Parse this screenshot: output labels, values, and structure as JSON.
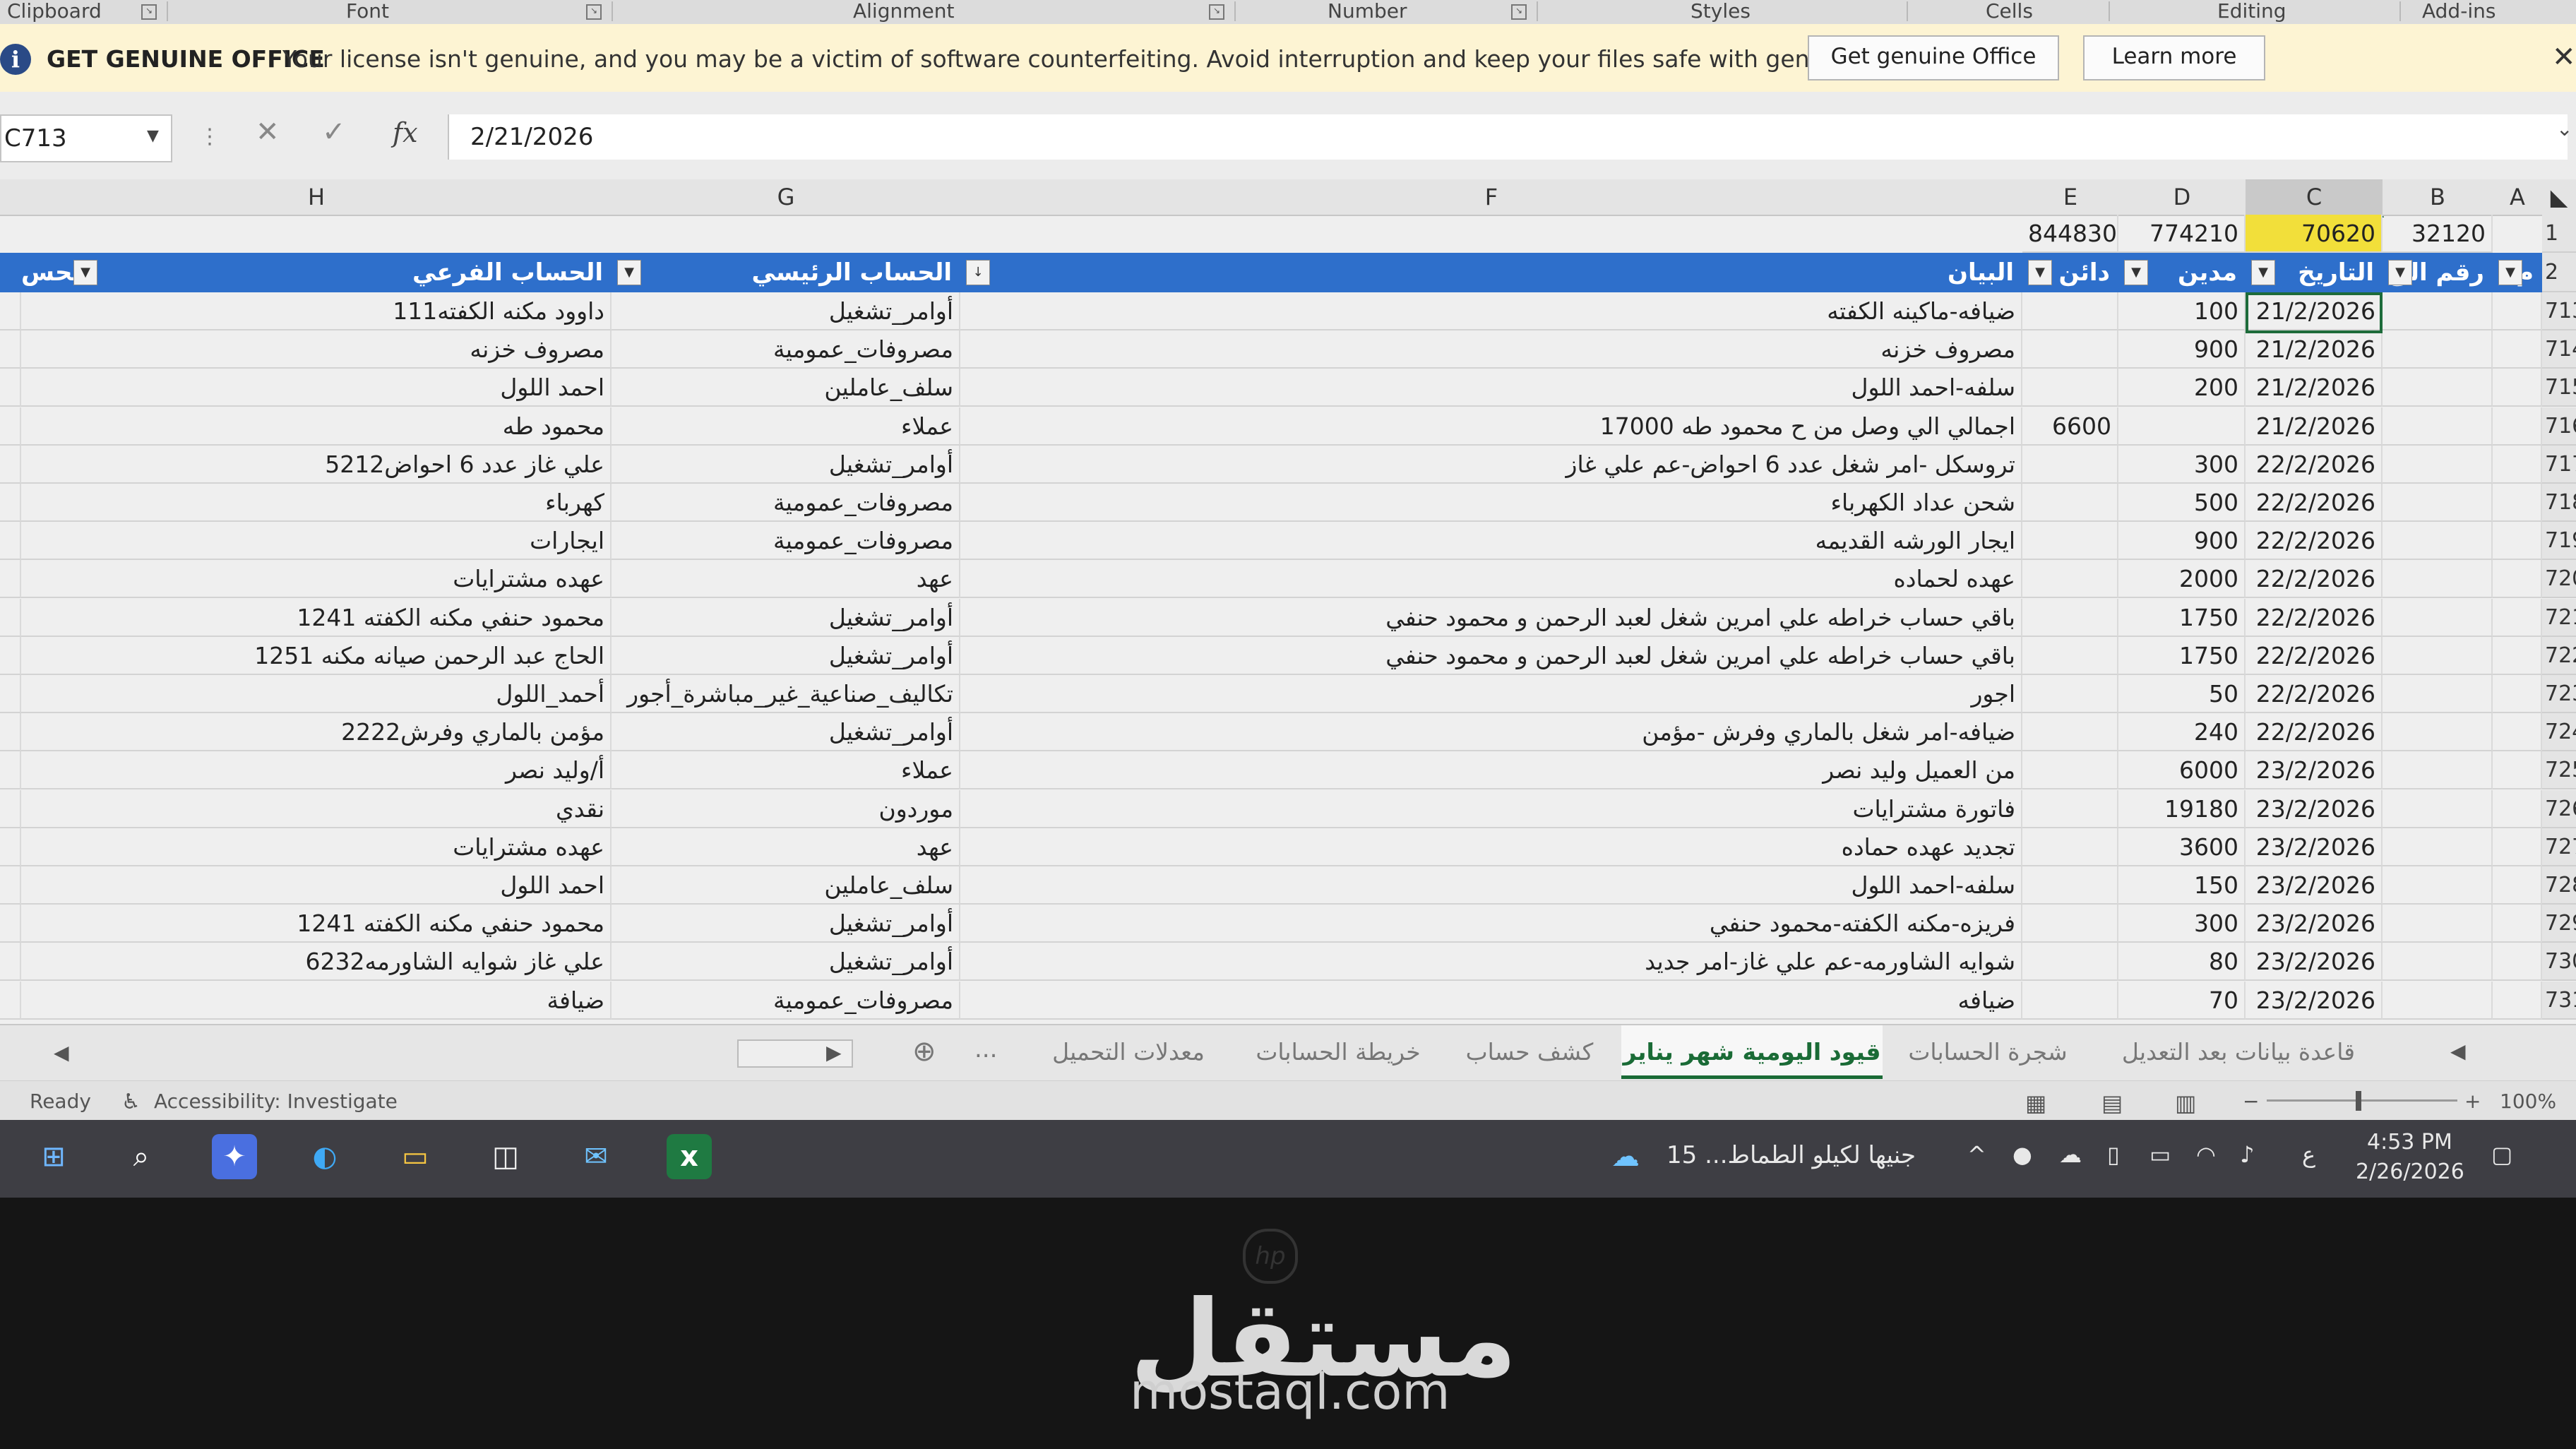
{
  "ribbon": {
    "groups": [
      "Clipboard",
      "Font",
      "Alignment",
      "Number",
      "Styles",
      "Cells",
      "Editing",
      "Add-ins"
    ]
  },
  "infobar": {
    "heading": "GET GENUINE OFFICE",
    "message": "Your license isn't genuine, and you may be a victim of software counterfeiting. Avoid interruption and keep your files safe with genuine Office today.",
    "btn_primary": "Get genuine Office",
    "btn_secondary": "Learn more"
  },
  "formula_bar": {
    "name_box": "C713",
    "value": "2/21/2026"
  },
  "columns": [
    "H",
    "G",
    "F",
    "E",
    "D",
    "C",
    "B",
    "A"
  ],
  "row_labels": [
    "1",
    "2",
    "713",
    "714",
    "715",
    "716",
    "717",
    "718",
    "719",
    "720",
    "721",
    "722",
    "723",
    "724",
    "725",
    "726",
    "727",
    "728",
    "729",
    "730",
    "731"
  ],
  "totals_row": {
    "E": "844830",
    "D": "774210",
    "C": "70620",
    "B": "32120"
  },
  "headers": {
    "I": "الحس",
    "H": "الحساب الفرعي",
    "G": "الحساب الرئيسي",
    "F": "البيان",
    "E": "دائن",
    "D": "مدين",
    "C": "التاريخ",
    "B": "رقم الق",
    "A": "م"
  },
  "rows": [
    {
      "H": "داوود مكنه الكفته111",
      "G": "أوامر_تشغيل",
      "F": "ضيافه-ماكينه الكفته",
      "E": "",
      "D": "100",
      "C": "21/2/2026"
    },
    {
      "H": "مصروف خزنه",
      "G": "مصروفات_عمومية",
      "F": "مصروف خزنه",
      "E": "",
      "D": "900",
      "C": "21/2/2026"
    },
    {
      "H": "احمد اللول",
      "G": "سلف_عاملين",
      "F": "سلفه-احمد اللول",
      "E": "",
      "D": "200",
      "C": "21/2/2026"
    },
    {
      "H": "محمود طه",
      "G": "عملاء",
      "F": "اجمالي الي وصل من ح محمود طه 17000",
      "E": "6600",
      "D": "",
      "C": "21/2/2026"
    },
    {
      "H": "علي غاز عدد 6 احواض5212",
      "G": "أوامر_تشغيل",
      "F": "تروسكل -امر شغل عدد 6 احواض-عم علي غاز",
      "E": "",
      "D": "300",
      "C": "22/2/2026"
    },
    {
      "H": "كهرباء",
      "G": "مصروفات_عمومية",
      "F": "شحن عداد الكهرباء",
      "E": "",
      "D": "500",
      "C": "22/2/2026"
    },
    {
      "H": "ايجارات",
      "G": "مصروفات_عمومية",
      "F": "ايجار الورشه القديمه",
      "E": "",
      "D": "900",
      "C": "22/2/2026"
    },
    {
      "H": "عهده مشترايات",
      "G": "عهد",
      "F": "عهده لحماده",
      "E": "",
      "D": "2000",
      "C": "22/2/2026"
    },
    {
      "H": "محمود حنفي مكنه الكفته 1241",
      "G": "أوامر_تشغيل",
      "F": "باقي حساب خراطه علي امرين شغل لعبد الرحمن و محمود حنفي",
      "E": "",
      "D": "1750",
      "C": "22/2/2026"
    },
    {
      "H": "الحاج عبد الرحمن صيانه مكنه   1251",
      "G": "أوامر_تشغيل",
      "F": "باقي حساب خراطه علي امرين شغل لعبد الرحمن و محمود حنفي",
      "E": "",
      "D": "1750",
      "C": "22/2/2026"
    },
    {
      "H": "أحمد_اللول",
      "G": "تكاليف_صناعية_غير_مباشرة_أجور",
      "F": "اجور",
      "E": "",
      "D": "50",
      "C": "22/2/2026"
    },
    {
      "H": "مؤمن بالماري وفرش2222",
      "G": "أوامر_تشغيل",
      "F": "ضيافه-امر شغل بالماري وفرش -مؤمن",
      "E": "",
      "D": "240",
      "C": "22/2/2026"
    },
    {
      "H": "أ/وليد نصر",
      "G": "عملاء",
      "F": "من العميل وليد نصر",
      "E": "",
      "D": "6000",
      "C": "23/2/2026"
    },
    {
      "H": "نقدي",
      "G": "موردون",
      "F": "فاتورة مشترايات",
      "E": "",
      "D": "19180",
      "C": "23/2/2026"
    },
    {
      "H": "عهده مشترايات",
      "G": "عهد",
      "F": "تجديد عهده حماده",
      "E": "",
      "D": "3600",
      "C": "23/2/2026"
    },
    {
      "H": "احمد اللول",
      "G": "سلف_عاملين",
      "F": "سلفه-احمد اللول",
      "E": "",
      "D": "150",
      "C": "23/2/2026"
    },
    {
      "H": "محمود حنفي مكنه الكفته 1241",
      "G": "أوامر_تشغيل",
      "F": "فريزه-مكنه الكفته-محمود حنفي",
      "E": "",
      "D": "300",
      "C": "23/2/2026"
    },
    {
      "H": "علي غاز شوايه الشاورمه6232",
      "G": "أوامر_تشغيل",
      "F": "شوايه الشاورمه-عم علي غاز-امر جديد",
      "E": "",
      "D": "80",
      "C": "23/2/2026"
    },
    {
      "H": "ضيافة",
      "G": "مصروفات_عمومية",
      "F": "ضيافه",
      "E": "",
      "D": "70",
      "C": "23/2/2026"
    }
  ],
  "sheet_tabs": [
    "قاعدة بيانات بعد التعديل",
    "شجرة الحسابات",
    "قيود اليومية شهر يناير",
    "كشف حساب",
    "خريطة الحسابات",
    "معدلات التحميل"
  ],
  "sheet_more": "...",
  "status": {
    "ready": "Ready",
    "accessibility": "Accessibility: Investigate",
    "zoom": "100%"
  },
  "taskbar": {
    "news": "جنيها لكيلو الطماط... 15",
    "time": "4:53 PM",
    "date": "2/26/2026",
    "lang": "ع"
  },
  "watermark": {
    "arabic": "مستقل",
    "latin": "mostaql.com"
  }
}
